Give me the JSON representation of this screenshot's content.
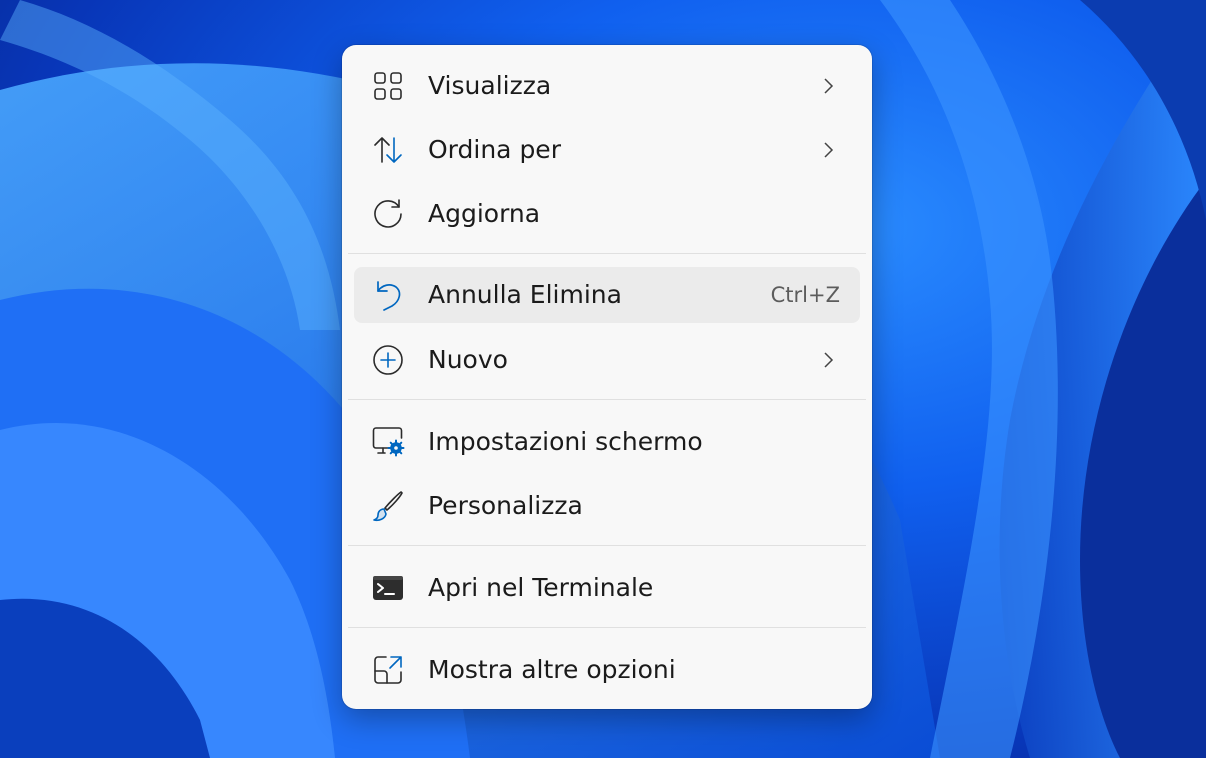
{
  "desktop": {
    "accent": "#0f5ef0"
  },
  "context_menu": {
    "items": [
      {
        "label": "Visualizza",
        "icon": "view-grid-icon",
        "submenu": true
      },
      {
        "label": "Ordina per",
        "icon": "sort-arrows-icon",
        "submenu": true
      },
      {
        "label": "Aggiorna",
        "icon": "refresh-icon",
        "submenu": false
      },
      {
        "label": "Annulla Elimina",
        "icon": "undo-icon",
        "shortcut": "Ctrl+Z",
        "highlighted": true
      },
      {
        "label": "Nuovo",
        "icon": "add-circle-icon",
        "submenu": true
      },
      {
        "label": "Impostazioni schermo",
        "icon": "display-settings-icon",
        "submenu": false
      },
      {
        "label": "Personalizza",
        "icon": "paintbrush-icon",
        "submenu": false
      },
      {
        "label": "Apri nel Terminale",
        "icon": "terminal-icon",
        "submenu": false
      },
      {
        "label": "Mostra altre opzioni",
        "icon": "show-more-options-icon",
        "submenu": false
      }
    ],
    "colors": {
      "background": "#f8f8f8",
      "hover": "#ebebeb",
      "icon_accent": "#0067c0",
      "text": "#1b1b1b"
    }
  }
}
